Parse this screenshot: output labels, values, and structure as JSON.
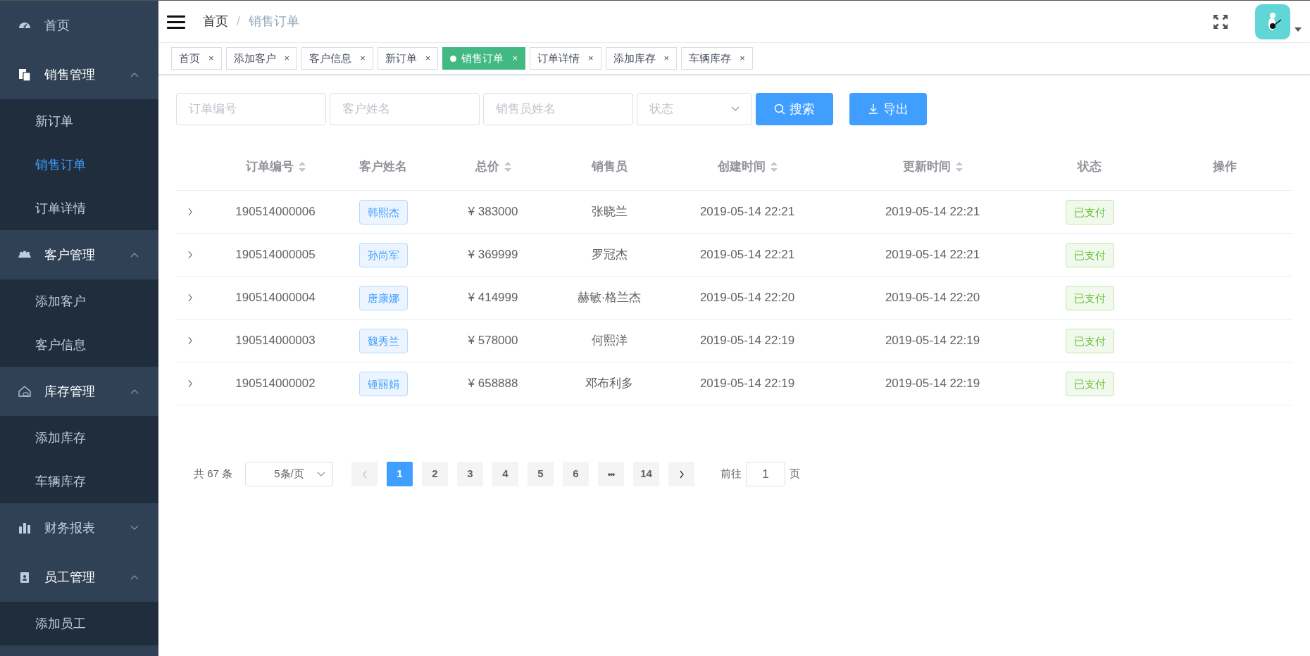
{
  "sidebar": {
    "items": [
      {
        "kind": "link",
        "label": "首页"
      },
      {
        "kind": "group",
        "label": "销售管理",
        "expanded": true,
        "children": [
          {
            "label": "新订单",
            "selected": false
          },
          {
            "label": "销售订单",
            "selected": true
          },
          {
            "label": "订单详情",
            "selected": false
          }
        ]
      },
      {
        "kind": "group",
        "label": "客户管理",
        "expanded": true,
        "children": [
          {
            "label": "添加客户",
            "selected": false
          },
          {
            "label": "客户信息",
            "selected": false
          }
        ]
      },
      {
        "kind": "group",
        "label": "库存管理",
        "expanded": true,
        "children": [
          {
            "label": "添加库存",
            "selected": false
          },
          {
            "label": "车辆库存",
            "selected": false
          }
        ]
      },
      {
        "kind": "group",
        "label": "财务报表",
        "expanded": false
      },
      {
        "kind": "group",
        "label": "员工管理",
        "expanded": true,
        "children": [
          {
            "label": "添加员工",
            "selected": false
          }
        ]
      }
    ]
  },
  "breadcrumb": [
    "首页",
    "销售订单"
  ],
  "breadcrumb_separator": "/",
  "tabs": [
    {
      "label": "首页",
      "selected": false
    },
    {
      "label": "添加客户",
      "selected": false
    },
    {
      "label": "客户信息",
      "selected": false
    },
    {
      "label": "新订单",
      "selected": false
    },
    {
      "label": "销售订单",
      "selected": true
    },
    {
      "label": "订单详情",
      "selected": false
    },
    {
      "label": "添加库存",
      "selected": false
    },
    {
      "label": "车辆库存",
      "selected": false
    }
  ],
  "tab_close": "×",
  "filters": [
    {
      "kind": "text",
      "placeholder": "订单编号"
    },
    {
      "kind": "text",
      "placeholder": "客户姓名"
    },
    {
      "kind": "text",
      "placeholder": "销售员姓名"
    },
    {
      "kind": "select",
      "placeholder": "状态"
    }
  ],
  "buttons": [
    {
      "kind": "search",
      "label": "搜索"
    },
    {
      "kind": "export",
      "label": "导出"
    }
  ],
  "table": {
    "columns": [
      {
        "label": "订单编号",
        "sortable": true
      },
      {
        "label": "客户姓名",
        "sortable": false
      },
      {
        "label": "总价",
        "sortable": true
      },
      {
        "label": "销售员",
        "sortable": false
      },
      {
        "label": "创建时间",
        "sortable": true
      },
      {
        "label": "更新时间",
        "sortable": true
      },
      {
        "label": "状态",
        "sortable": false
      },
      {
        "label": "操作",
        "sortable": false
      }
    ],
    "rows": [
      {
        "expanded": false,
        "order_no": "190514000006",
        "customer": "韩熙杰",
        "price": "¥ 383000",
        "salesperson": "张晓兰",
        "created": "2019-05-14 22:21",
        "updated": "2019-05-14 22:21",
        "status": "已支付"
      },
      {
        "expanded": false,
        "order_no": "190514000005",
        "customer": "孙尚军",
        "price": "¥ 369999",
        "salesperson": "罗冠杰",
        "created": "2019-05-14 22:21",
        "updated": "2019-05-14 22:21",
        "status": "已支付"
      },
      {
        "expanded": false,
        "order_no": "190514000004",
        "customer": "唐康娜",
        "price": "¥ 414999",
        "salesperson": "赫敏·格兰杰",
        "created": "2019-05-14 22:20",
        "updated": "2019-05-14 22:20",
        "status": "已支付"
      },
      {
        "expanded": false,
        "order_no": "190514000003",
        "customer": "魏秀兰",
        "price": "¥ 578000",
        "salesperson": "何熙洋",
        "created": "2019-05-14 22:19",
        "updated": "2019-05-14 22:19",
        "status": "已支付"
      },
      {
        "expanded": false,
        "order_no": "190514000002",
        "customer": "锺丽娟",
        "price": "¥ 658888",
        "salesperson": "邓布利多",
        "created": "2019-05-14 22:19",
        "updated": "2019-05-14 22:19",
        "status": "已支付"
      }
    ]
  },
  "pagination": {
    "total": "共 67 条",
    "page_size": "5条/页",
    "prev_disabled": true,
    "pages": [
      {
        "kind": "page",
        "label": "1",
        "selected": true
      },
      {
        "kind": "page",
        "label": "2",
        "selected": false
      },
      {
        "kind": "page",
        "label": "3",
        "selected": false
      },
      {
        "kind": "page",
        "label": "4",
        "selected": false
      },
      {
        "kind": "page",
        "label": "5",
        "selected": false
      },
      {
        "kind": "page",
        "label": "6",
        "selected": false
      },
      {
        "kind": "more",
        "label": "•••",
        "selected": false
      },
      {
        "kind": "page",
        "label": "14",
        "selected": false
      }
    ],
    "goto_label": "前往",
    "goto_value": "1",
    "goto_suffix": "页"
  }
}
